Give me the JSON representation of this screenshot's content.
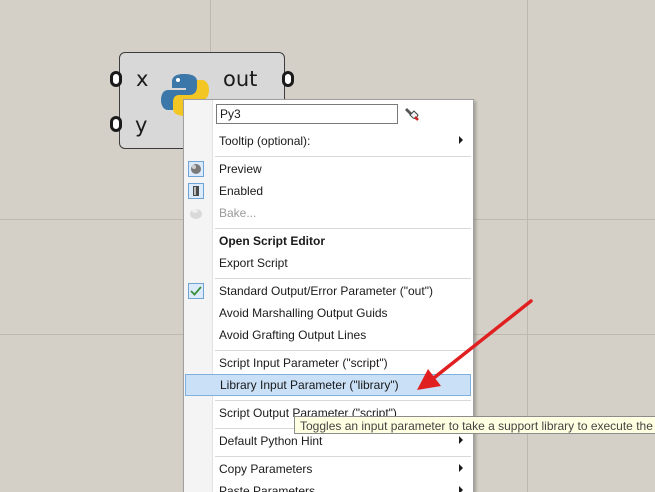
{
  "component": {
    "inputs": [
      "x",
      "y"
    ],
    "output": "out",
    "icon": "python-logo-icon"
  },
  "menu": {
    "name_value": "Py3",
    "name_icon": "paint-brush-icon",
    "items": {
      "tooltip": "Tooltip (optional):",
      "preview": "Preview",
      "enabled": "Enabled",
      "bake": "Bake...",
      "open_editor": "Open Script Editor",
      "export_script": "Export Script",
      "std_output": "Standard Output/Error Parameter (\"out\")",
      "avoid_marshalling": "Avoid Marshalling Output Guids",
      "avoid_grafting": "Avoid Grafting Output Lines",
      "script_input": "Script Input Parameter (\"script\")",
      "library_input": "Library Input Parameter (\"library\")",
      "script_output": "Script Output Parameter (\"script\")",
      "default_hint": "Default Python Hint",
      "copy_params": "Copy Parameters",
      "paste_params": "Paste Parameters"
    }
  },
  "tooltip": "Toggles an input parameter to take a support library to execute the s",
  "colors": {
    "canvas": "#d4d0c8",
    "highlight": "#c9e0f7",
    "arrow": "#e02020",
    "tooltip_bg": "#ffffe1"
  }
}
